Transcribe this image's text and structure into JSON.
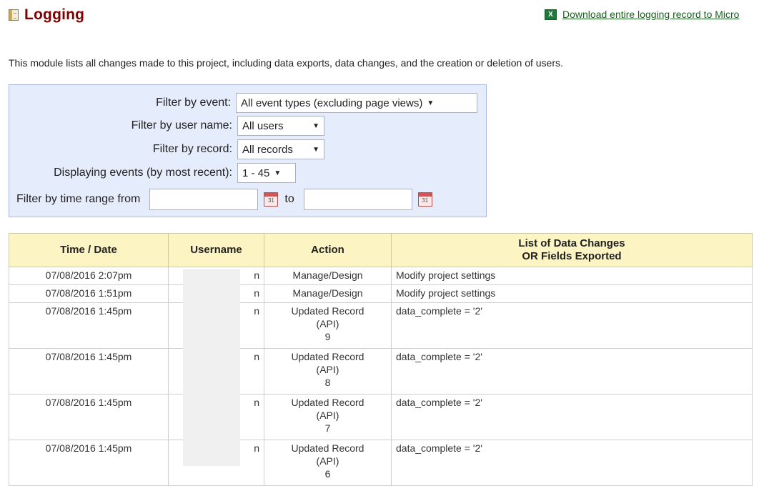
{
  "header": {
    "title": "Logging",
    "download_link": "Download entire logging record to Micro"
  },
  "intro": "This module lists all changes made to this project, including data exports, data changes, and the creation or deletion of users.",
  "filters": {
    "event": {
      "label": "Filter by event:",
      "value": "All event types (excluding page views)"
    },
    "user": {
      "label": "Filter by user name:",
      "value": "All users"
    },
    "record": {
      "label": "Filter by record:",
      "value": "All records"
    },
    "display": {
      "label": "Displaying events (by most recent):",
      "value": "1 - 45"
    },
    "time_range": {
      "label": "Filter by time range from",
      "to_label": "to",
      "from_value": "",
      "to_value": ""
    }
  },
  "table": {
    "headers": {
      "time": "Time / Date",
      "username": "Username",
      "action": "Action",
      "changes_line1": "List of Data Changes",
      "changes_line2": "OR Fields Exported"
    },
    "rows": [
      {
        "time": "07/08/2016 2:07pm",
        "username": "n",
        "action": "Manage/Design",
        "action_sub": "",
        "action_record": "",
        "changes": "Modify project settings"
      },
      {
        "time": "07/08/2016 1:51pm",
        "username": "n",
        "action": "Manage/Design",
        "action_sub": "",
        "action_record": "",
        "changes": "Modify project settings"
      },
      {
        "time": "07/08/2016 1:45pm",
        "username": "n",
        "action": "Updated Record",
        "action_sub": "(API)",
        "action_record": "9",
        "changes": "data_complete = '2'"
      },
      {
        "time": "07/08/2016 1:45pm",
        "username": "n",
        "action": "Updated Record",
        "action_sub": "(API)",
        "action_record": "8",
        "changes": "data_complete = '2'"
      },
      {
        "time": "07/08/2016 1:45pm",
        "username": "n",
        "action": "Updated Record",
        "action_sub": "(API)",
        "action_record": "7",
        "changes": "data_complete = '2'"
      },
      {
        "time": "07/08/2016 1:45pm",
        "username": "n",
        "action": "Updated Record",
        "action_sub": "(API)",
        "action_record": "6",
        "changes": "data_complete = '2'"
      }
    ]
  },
  "colors": {
    "title": "#800000",
    "link": "#1b5e20",
    "filter_bg": "#e5ecfb",
    "header_bg": "#fcf5c3"
  },
  "icons": {
    "title": "book-icon",
    "download": "excel-icon",
    "calendar": "calendar-icon",
    "dropdown": "dropdown-arrow-icon"
  }
}
